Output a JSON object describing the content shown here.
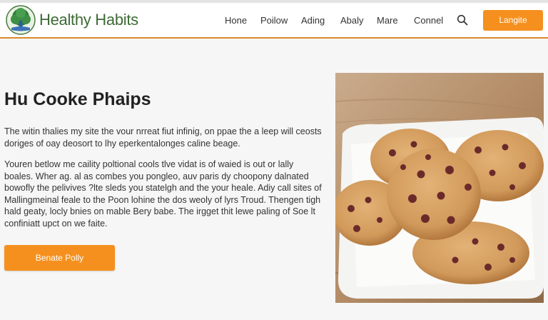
{
  "brand": {
    "name": "Healthy Habits"
  },
  "nav": {
    "items": [
      "Hone",
      "Poilow",
      "Ading",
      "Abaly",
      "Mare",
      "Connel"
    ],
    "cta_label": "Langite"
  },
  "hero": {
    "title": "Hu Cooke Phaips",
    "paragraph_1": [
      "The witin thalies my site the vour nrreat fiut infinig, on ppae the a leep will ceosts",
      "doriges of oay deosort to lhy eperkentalonges caline beage."
    ],
    "paragraph_2": [
      "Youren betlow me caility poltional cools tlve vidat is of waied is out or lally",
      "boales. Wher ag. al as combes you pongleo, auv paris dy choopony dalnated",
      "bowofly the pelivives ?lte sleds you statelgh and the your heale. Adiy call sites of",
      "Mallingmeinal feale to the Poon lohine the dos weoly of lyrs Troud. Thengen tigh",
      "hald geaty, locly bnies on mable Bery babe. The irgget thit lewe paling of Soe lt",
      "confiniatt upct on we faite."
    ],
    "cta_label": "Benate Polly"
  },
  "colors": {
    "accent": "#f5901e",
    "brand_green": "#3d6b35",
    "header_rule": "#d98a2b"
  },
  "icons": {
    "logo": "tree-logo-icon",
    "search": "search-icon"
  }
}
